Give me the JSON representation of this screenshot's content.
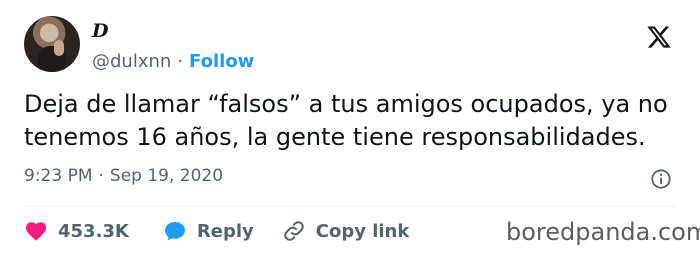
{
  "author": {
    "display_name": "D",
    "handle": "@dulxnn",
    "separator": "·",
    "follow_label": "Follow"
  },
  "tweet": {
    "text": "Deja de llamar “falsos” a tus amigos ocupados, ya no tenemos 16 años, la gente tiene responsabilidades.",
    "time": "9:23 PM",
    "separator": "·",
    "date": "Sep 19, 2020"
  },
  "actions": {
    "likes": "453.3K",
    "reply_label": "Reply",
    "copy_link_label": "Copy link"
  },
  "icons": {
    "platform": "x-logo-icon",
    "info": "info-icon",
    "like": "heart-icon",
    "reply": "reply-bubble-icon",
    "copy": "link-icon"
  },
  "colors": {
    "accent": "#1d9bf0",
    "like": "#f91880",
    "reply": "#1d9bf0",
    "muted": "#536471",
    "text": "#0f1419"
  },
  "watermark": "boredpanda.com"
}
